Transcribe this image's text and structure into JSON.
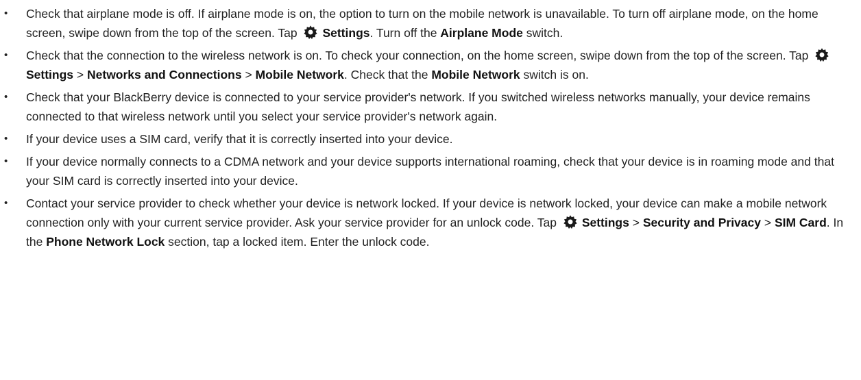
{
  "bullet_glyph": "•",
  "icon": "gear-icon",
  "items": [
    {
      "t0": "Check that airplane mode is off. If airplane mode is on, the option to turn on the mobile network is unavailable. To turn off airplane mode, on the home screen, swipe down from the top of the screen. Tap ",
      "b0": "Settings",
      "t1": ". Turn off the ",
      "b1": "Airplane Mode",
      "t2": " switch."
    },
    {
      "t0": "Check that the connection to the wireless network is on. To check your connection, on the home screen, swipe down from the top of the screen. Tap ",
      "b0": "Settings",
      "t1": " > ",
      "b1": "Networks and Connections",
      "t2": " > ",
      "b2": "Mobile Network",
      "t3": ". Check that the ",
      "b3": "Mobile Network",
      "t4": " switch is on."
    },
    {
      "text": "Check that your BlackBerry device is connected to your service provider's network. If you switched wireless networks manually, your device remains connected to that wireless network until you select your service provider's network again."
    },
    {
      "text": "If your device uses a SIM card, verify that it is correctly inserted into your device."
    },
    {
      "text": "If your device normally connects to a CDMA network and your device supports international roaming, check that your device is in roaming mode and that your SIM card is correctly inserted into your device."
    },
    {
      "t0": "Contact your service provider to check whether your device is network locked. If your device is network locked, your device can make a mobile network connection only with your current service provider. Ask your service provider for an unlock code. Tap ",
      "b0": "Settings",
      "t1": " > ",
      "b1": "Security and Privacy",
      "t2": " > ",
      "b2": "SIM Card",
      "t3": ". In the ",
      "b3": "Phone Network Lock",
      "t4": " section, tap a locked item. Enter the unlock code."
    }
  ]
}
